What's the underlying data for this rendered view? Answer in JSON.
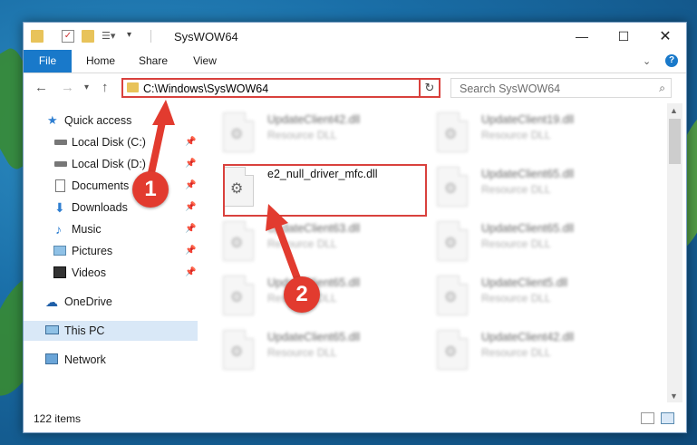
{
  "window": {
    "title": "SysWOW64"
  },
  "ribbon": {
    "tabs": [
      "File",
      "Home",
      "Share",
      "View"
    ]
  },
  "address": {
    "path": "C:\\Windows\\SysWOW64"
  },
  "search": {
    "placeholder": "Search SysWOW64"
  },
  "sidebar": {
    "items": [
      {
        "label": "Quick access"
      },
      {
        "label": "Local Disk (C:)"
      },
      {
        "label": "Local Disk (D:)"
      },
      {
        "label": "Documents"
      },
      {
        "label": "Downloads"
      },
      {
        "label": "Music"
      },
      {
        "label": "Pictures"
      },
      {
        "label": "Videos"
      },
      {
        "label": "OneDrive"
      },
      {
        "label": "This PC"
      },
      {
        "label": "Network"
      }
    ]
  },
  "files": [
    {
      "name": "UpdateClient42.dll",
      "type": "Resource DLL"
    },
    {
      "name": "UpdateClient19.dll",
      "type": "Resource DLL"
    },
    {
      "name": "e2_null_driver_mfc.dll",
      "type": ""
    },
    {
      "name": "UpdateClient65.dll",
      "type": "Resource DLL"
    },
    {
      "name": "UpdateClient63.dll",
      "type": "Resource DLL"
    },
    {
      "name": "UpdateClient65.dll",
      "type": "Resource DLL"
    },
    {
      "name": "UpdateClient65.dll",
      "type": "Resource DLL"
    },
    {
      "name": "UpdateClient5.dll",
      "type": "Resource DLL"
    },
    {
      "name": "UpdateClient65.dll",
      "type": "Resource DLL"
    },
    {
      "name": "UpdateClient42.dll",
      "type": "Resource DLL"
    }
  ],
  "status": {
    "item_count": "122 items"
  },
  "badges": {
    "step1": "1",
    "step2": "2"
  },
  "colors": {
    "accent": "#1979ca",
    "highlight": "#d9413d",
    "badge": "#e23b2f"
  }
}
